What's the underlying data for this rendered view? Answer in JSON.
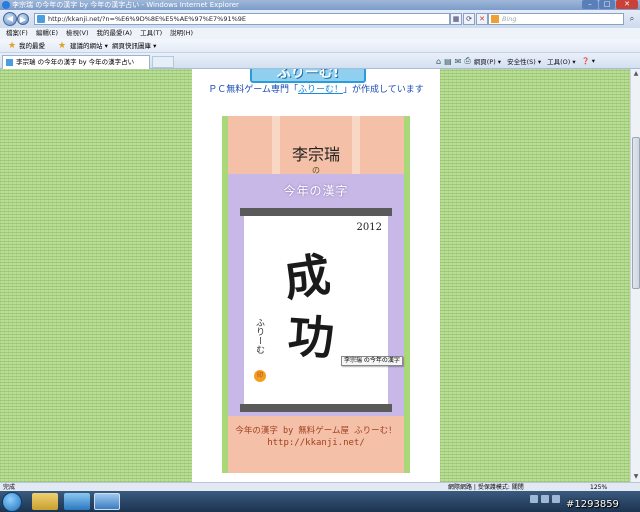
{
  "window": {
    "title": "李宗瑞 の今年の漢字 by 今年の漢字占い - Windows Internet Explorer",
    "controls": [
      "–",
      "□",
      "✕"
    ]
  },
  "address_bar": {
    "url": "http://kkanji.net/?n=%E6%9D%8E%E5%AE%97%E7%91%9E",
    "search_placeholder": "Bing",
    "refresh": "⟳",
    "stop": "✕"
  },
  "menu": [
    "檔案(F)",
    "編輯(E)",
    "檢視(V)",
    "我的最愛(A)",
    "工具(T)",
    "說明(H)"
  ],
  "favorites_bar": {
    "favorites_label": "我的最愛",
    "suggested_sites": "建議的網站 ▾",
    "web_slice_gallery": "網頁快訊圖庫 ▾"
  },
  "tab": {
    "label": "李宗瑞 の今年の漢字 by 今年の漢字占い"
  },
  "command_bar": {
    "page": "網頁(P) ▾",
    "safety": "安全性(S) ▾",
    "tools": "工具(O) ▾",
    "help": "❓ ▾"
  },
  "page": {
    "logo": "ふりーむ!",
    "tagline_pre": "ＰＣ無料ゲーム専門「",
    "tagline_link": "ふりーむ！",
    "tagline_post": "」が作成しています",
    "scroll": {
      "name": "李宗瑞",
      "no": "の",
      "banner": "今年の漢字",
      "year": "2012",
      "kanji_1": "成",
      "kanji_2": "功",
      "signature": "ふりーむ",
      "seal": "印",
      "footer_1": "今年の漢字 by 無料ゲーム屋 ふりーむ！",
      "footer_2": "http://kkanji.net/"
    },
    "tooltip": "李宗瑞 の今年の漢字"
  },
  "status_bar": {
    "text": "完成",
    "zone": "網際網路 | 受保護模式: 關閉",
    "zoom": "125%"
  },
  "watermark": "#1293859"
}
